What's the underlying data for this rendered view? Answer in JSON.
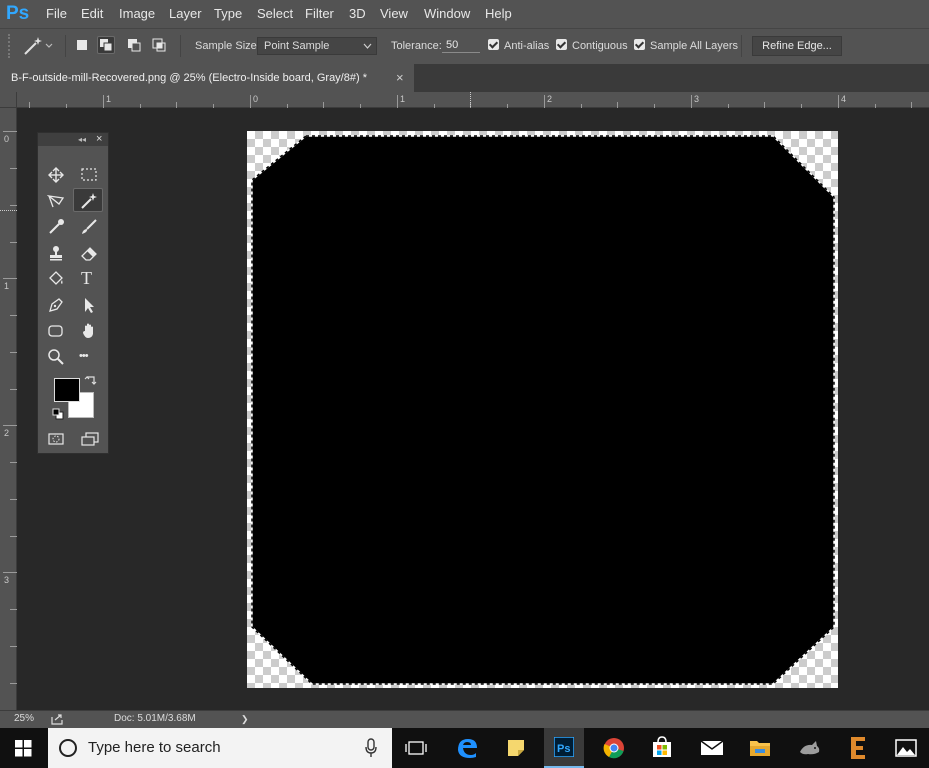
{
  "app": {
    "logo": "Ps",
    "accent": "#31a8ff"
  },
  "menu": [
    "File",
    "Edit",
    "Image",
    "Layer",
    "Type",
    "Select",
    "Filter",
    "3D",
    "View",
    "Window",
    "Help"
  ],
  "options": {
    "sample_size_label": "Sample Size:",
    "sample_size_value": "Point Sample",
    "tolerance_label": "Tolerance:",
    "tolerance_value": "50",
    "anti_alias": {
      "label": "Anti-alias",
      "checked": true
    },
    "contiguous": {
      "label": "Contiguous",
      "checked": true
    },
    "sample_all_layers": {
      "label": "Sample All Layers",
      "checked": true
    },
    "refine_edge_label": "Refine Edge..."
  },
  "tab": {
    "title": "B-F-outside-mill-Recovered.png @ 25% (Electro-Inside board, Gray/8#) *",
    "close": "×"
  },
  "ruler_top": [
    "1",
    "0",
    "1",
    "2",
    "3",
    "4"
  ],
  "ruler_left": [
    "0",
    "1",
    "2",
    "3"
  ],
  "toolbox": {
    "collapse": "◂◂",
    "close": "×",
    "tools": [
      "move-tool",
      "marquee-tool",
      "lasso-tool",
      "magic-wand-tool",
      "eyedropper-tool",
      "brush-tool",
      "stamp-tool",
      "eraser-tool",
      "paint-bucket-tool",
      "type-tool",
      "pen-tool",
      "path-selection-tool",
      "rectangle-tool",
      "hand-tool",
      "zoom-tool",
      "more-tools"
    ],
    "active_tool": "magic-wand-tool",
    "type_glyph": "T",
    "more_glyph": "•••",
    "foreground_color": "#000000",
    "background_color": "#ffffff"
  },
  "status": {
    "zoom": "25%",
    "doc": "Doc: 5.01M/3.68M",
    "arrow": "❯"
  },
  "taskbar": {
    "search_placeholder": "Type here to search"
  }
}
